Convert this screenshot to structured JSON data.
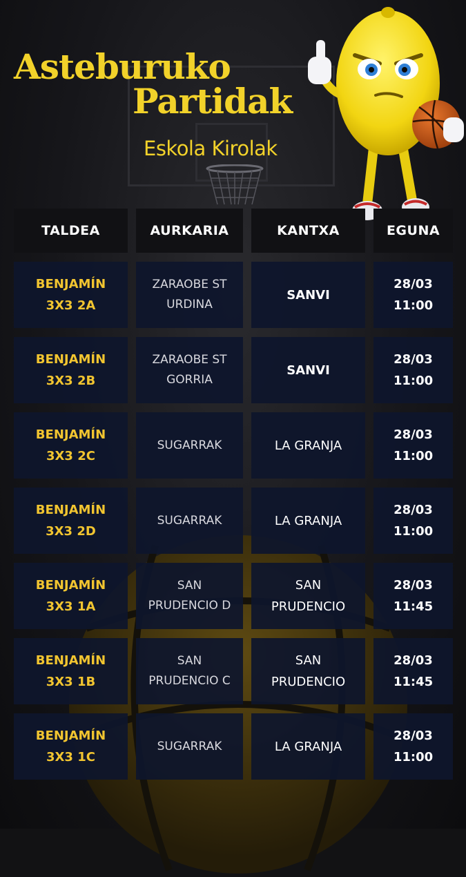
{
  "header": {
    "title_line1": "Asteburuko",
    "title_line2": "Partidak",
    "subtitle": "Eskola Kirolak"
  },
  "table": {
    "columns": [
      "TALDEA",
      "AURKARIA",
      "KANTXA",
      "EGUNA"
    ],
    "rows": [
      {
        "taldea": [
          "BENJAMÍN",
          "3X3 2A"
        ],
        "aurkaria": [
          "ZARAOBE ST",
          "URDINA"
        ],
        "kantxa": [
          "SANVI"
        ],
        "kantxa_bold": true,
        "eguna": [
          "28/03",
          "11:00"
        ]
      },
      {
        "taldea": [
          "BENJAMÍN",
          "3X3 2B"
        ],
        "aurkaria": [
          "ZARAOBE ST",
          "GORRIA"
        ],
        "kantxa": [
          "SANVI"
        ],
        "kantxa_bold": true,
        "eguna": [
          "28/03",
          "11:00"
        ]
      },
      {
        "taldea": [
          "BENJAMÍN",
          "3X3 2C"
        ],
        "aurkaria": [
          "SUGARRAK"
        ],
        "kantxa": [
          "LA GRANJA"
        ],
        "kantxa_bold": false,
        "eguna": [
          "28/03",
          "11:00"
        ]
      },
      {
        "taldea": [
          "BENJAMÍN",
          "3X3 2D"
        ],
        "aurkaria": [
          "SUGARRAK"
        ],
        "kantxa": [
          "LA GRANJA"
        ],
        "kantxa_bold": false,
        "eguna": [
          "28/03",
          "11:00"
        ]
      },
      {
        "taldea": [
          "BENJAMÍN",
          "3X3 1A"
        ],
        "aurkaria": [
          "SAN",
          "PRUDENCIO D"
        ],
        "kantxa": [
          "SAN",
          "PRUDENCIO"
        ],
        "kantxa_bold": false,
        "eguna": [
          "28/03",
          "11:45"
        ]
      },
      {
        "taldea": [
          "BENJAMÍN",
          "3X3 1B"
        ],
        "aurkaria": [
          "SAN",
          "PRUDENCIO C"
        ],
        "kantxa": [
          "SAN",
          "PRUDENCIO"
        ],
        "kantxa_bold": false,
        "eguna": [
          "28/03",
          "11:45"
        ]
      },
      {
        "taldea": [
          "BENJAMÍN",
          "3X3 1C"
        ],
        "aurkaria": [
          "SUGARRAK"
        ],
        "kantxa": [
          "LA GRANJA"
        ],
        "kantxa_bold": false,
        "eguna": [
          "28/03",
          "11:00"
        ]
      }
    ]
  },
  "colors": {
    "accent_yellow": "#f2c530",
    "title_yellow": "#f2d22a",
    "cell_navy": "#0e162c",
    "header_black": "#111114"
  },
  "icons": {
    "mascot": "lemon-mascot-thumbs-up-basketball",
    "background": "basketball-hoop-and-ball"
  }
}
